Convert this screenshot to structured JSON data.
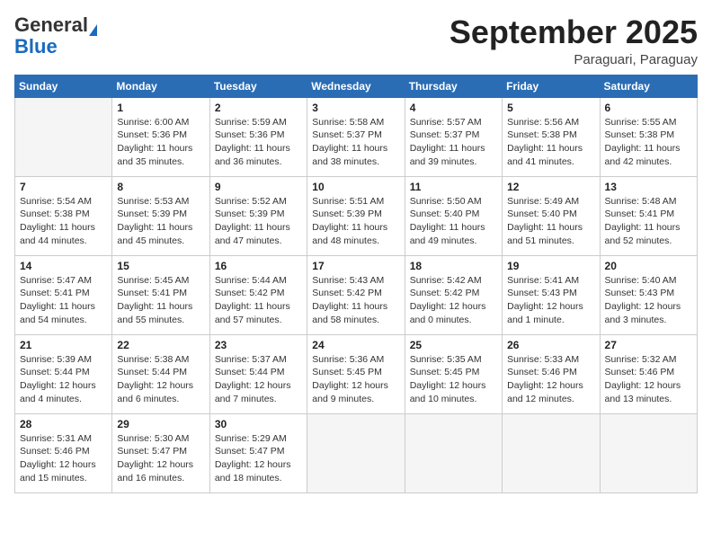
{
  "header": {
    "logo_line1": "General",
    "logo_line2": "Blue",
    "month": "September 2025",
    "location": "Paraguari, Paraguay"
  },
  "weekdays": [
    "Sunday",
    "Monday",
    "Tuesday",
    "Wednesday",
    "Thursday",
    "Friday",
    "Saturday"
  ],
  "weeks": [
    [
      {
        "day": "",
        "sunrise": "",
        "sunset": "",
        "daylight": ""
      },
      {
        "day": "1",
        "sunrise": "6:00 AM",
        "sunset": "5:36 PM",
        "daylight": "11 hours and 35 minutes."
      },
      {
        "day": "2",
        "sunrise": "5:59 AM",
        "sunset": "5:36 PM",
        "daylight": "11 hours and 36 minutes."
      },
      {
        "day": "3",
        "sunrise": "5:58 AM",
        "sunset": "5:37 PM",
        "daylight": "11 hours and 38 minutes."
      },
      {
        "day": "4",
        "sunrise": "5:57 AM",
        "sunset": "5:37 PM",
        "daylight": "11 hours and 39 minutes."
      },
      {
        "day": "5",
        "sunrise": "5:56 AM",
        "sunset": "5:38 PM",
        "daylight": "11 hours and 41 minutes."
      },
      {
        "day": "6",
        "sunrise": "5:55 AM",
        "sunset": "5:38 PM",
        "daylight": "11 hours and 42 minutes."
      }
    ],
    [
      {
        "day": "7",
        "sunrise": "5:54 AM",
        "sunset": "5:38 PM",
        "daylight": "11 hours and 44 minutes."
      },
      {
        "day": "8",
        "sunrise": "5:53 AM",
        "sunset": "5:39 PM",
        "daylight": "11 hours and 45 minutes."
      },
      {
        "day": "9",
        "sunrise": "5:52 AM",
        "sunset": "5:39 PM",
        "daylight": "11 hours and 47 minutes."
      },
      {
        "day": "10",
        "sunrise": "5:51 AM",
        "sunset": "5:39 PM",
        "daylight": "11 hours and 48 minutes."
      },
      {
        "day": "11",
        "sunrise": "5:50 AM",
        "sunset": "5:40 PM",
        "daylight": "11 hours and 49 minutes."
      },
      {
        "day": "12",
        "sunrise": "5:49 AM",
        "sunset": "5:40 PM",
        "daylight": "11 hours and 51 minutes."
      },
      {
        "day": "13",
        "sunrise": "5:48 AM",
        "sunset": "5:41 PM",
        "daylight": "11 hours and 52 minutes."
      }
    ],
    [
      {
        "day": "14",
        "sunrise": "5:47 AM",
        "sunset": "5:41 PM",
        "daylight": "11 hours and 54 minutes."
      },
      {
        "day": "15",
        "sunrise": "5:45 AM",
        "sunset": "5:41 PM",
        "daylight": "11 hours and 55 minutes."
      },
      {
        "day": "16",
        "sunrise": "5:44 AM",
        "sunset": "5:42 PM",
        "daylight": "11 hours and 57 minutes."
      },
      {
        "day": "17",
        "sunrise": "5:43 AM",
        "sunset": "5:42 PM",
        "daylight": "11 hours and 58 minutes."
      },
      {
        "day": "18",
        "sunrise": "5:42 AM",
        "sunset": "5:42 PM",
        "daylight": "12 hours and 0 minutes."
      },
      {
        "day": "19",
        "sunrise": "5:41 AM",
        "sunset": "5:43 PM",
        "daylight": "12 hours and 1 minute."
      },
      {
        "day": "20",
        "sunrise": "5:40 AM",
        "sunset": "5:43 PM",
        "daylight": "12 hours and 3 minutes."
      }
    ],
    [
      {
        "day": "21",
        "sunrise": "5:39 AM",
        "sunset": "5:44 PM",
        "daylight": "12 hours and 4 minutes."
      },
      {
        "day": "22",
        "sunrise": "5:38 AM",
        "sunset": "5:44 PM",
        "daylight": "12 hours and 6 minutes."
      },
      {
        "day": "23",
        "sunrise": "5:37 AM",
        "sunset": "5:44 PM",
        "daylight": "12 hours and 7 minutes."
      },
      {
        "day": "24",
        "sunrise": "5:36 AM",
        "sunset": "5:45 PM",
        "daylight": "12 hours and 9 minutes."
      },
      {
        "day": "25",
        "sunrise": "5:35 AM",
        "sunset": "5:45 PM",
        "daylight": "12 hours and 10 minutes."
      },
      {
        "day": "26",
        "sunrise": "5:33 AM",
        "sunset": "5:46 PM",
        "daylight": "12 hours and 12 minutes."
      },
      {
        "day": "27",
        "sunrise": "5:32 AM",
        "sunset": "5:46 PM",
        "daylight": "12 hours and 13 minutes."
      }
    ],
    [
      {
        "day": "28",
        "sunrise": "5:31 AM",
        "sunset": "5:46 PM",
        "daylight": "12 hours and 15 minutes."
      },
      {
        "day": "29",
        "sunrise": "5:30 AM",
        "sunset": "5:47 PM",
        "daylight": "12 hours and 16 minutes."
      },
      {
        "day": "30",
        "sunrise": "5:29 AM",
        "sunset": "5:47 PM",
        "daylight": "12 hours and 18 minutes."
      },
      {
        "day": "",
        "sunrise": "",
        "sunset": "",
        "daylight": ""
      },
      {
        "day": "",
        "sunrise": "",
        "sunset": "",
        "daylight": ""
      },
      {
        "day": "",
        "sunrise": "",
        "sunset": "",
        "daylight": ""
      },
      {
        "day": "",
        "sunrise": "",
        "sunset": "",
        "daylight": ""
      }
    ]
  ]
}
